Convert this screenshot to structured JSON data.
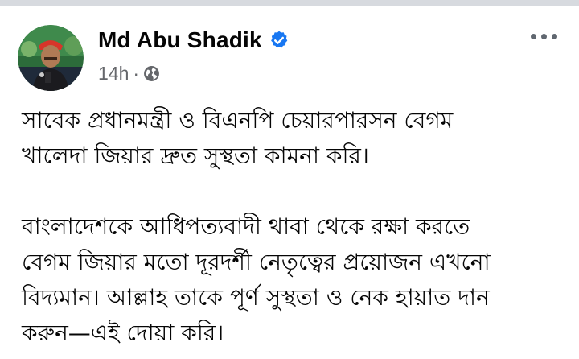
{
  "post": {
    "author_name": "Md Abu Shadik",
    "author_verified": true,
    "timestamp": "14h",
    "separator": "·",
    "audience_icon": "globe-icon",
    "more_icon": "more-options-icon",
    "paragraphs": [
      {
        "lines": [
          "সাবেক প্রধানমন্ত্রী ও বিএনপি চেয়ারপারসন বেগম",
          "খালেদা জিয়ার দ্রুত সুস্থতা কামনা করি।"
        ]
      },
      {
        "lines": [
          "বাংলাদেশকে আধিপত্যবাদী থাবা থেকে রক্ষা করতে",
          "বেগম জিয়ার মতো দূরদর্শী নেতৃত্বের প্রয়োজন এখনো",
          "বিদ্যমান। আল্লাহ তাকে পূর্ণ সুস্থতা ও নেক হায়াত দান",
          "করুন—এই দোয়া করি।"
        ]
      }
    ]
  },
  "colors": {
    "verified_badge": "#1877f2",
    "meta_text": "#65676b",
    "top_strip": "#d7dadf"
  }
}
